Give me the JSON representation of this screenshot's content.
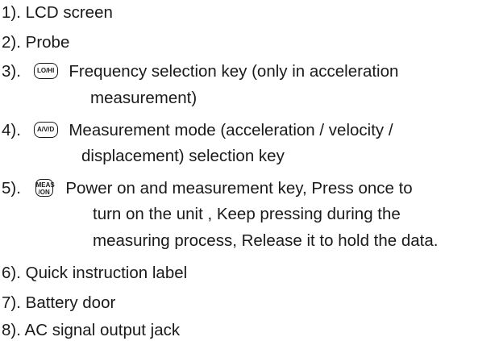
{
  "items": [
    {
      "num": "1).",
      "text": "LCD screen"
    },
    {
      "num": "2).",
      "text": "Probe"
    },
    {
      "num": "3).",
      "key": "LO/HI",
      "text": "Frequency selection key (only in acceleration",
      "cont": [
        "measurement)"
      ]
    },
    {
      "num": "4).",
      "key": "A/V/D",
      "text": "Measurement  mode (acceleration / velocity /",
      "cont": [
        "displacement) selection key"
      ]
    },
    {
      "num": "5).",
      "key_lines": [
        "MEAS",
        "/ON"
      ],
      "text": "Power on and measurement key, Press once to",
      "cont": [
        "turn on the unit , Keep pressing during the",
        "measuring process, Release it to hold the data."
      ]
    },
    {
      "num": "6).",
      "text": "Quick instruction label"
    },
    {
      "num": "7).",
      "text": "Battery door"
    },
    {
      "num": "8).",
      "text": "AC signal output jack"
    }
  ]
}
